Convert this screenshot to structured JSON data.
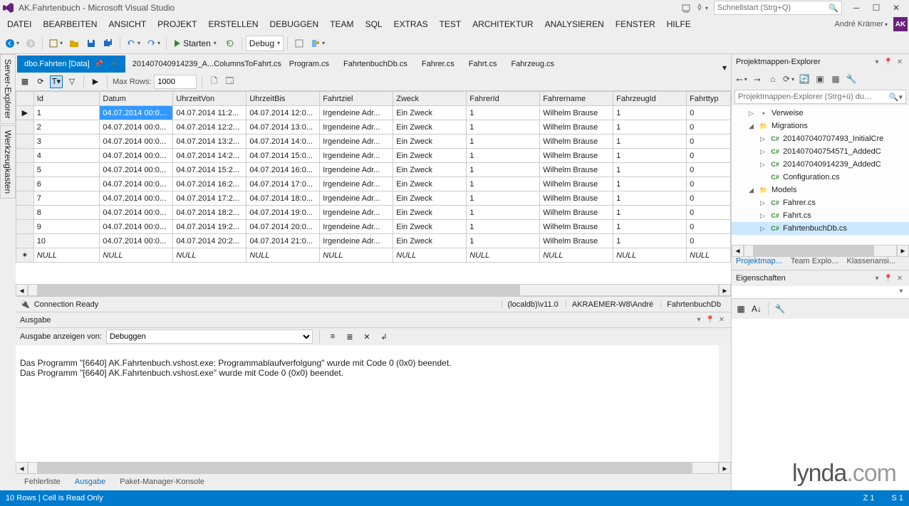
{
  "title": "AK.Fahrtenbuch - Microsoft Visual Studio",
  "quicklaunch_placeholder": "Schnellstart (Strg+Q)",
  "user_name": "André Krämer",
  "user_initials": "AK",
  "menu": [
    "DATEI",
    "BEARBEITEN",
    "ANSICHT",
    "PROJEKT",
    "ERSTELLEN",
    "DEBUGGEN",
    "TEAM",
    "SQL",
    "EXTRAS",
    "TEST",
    "ARCHITEKTUR",
    "ANALYSIEREN",
    "FENSTER",
    "HILFE"
  ],
  "toolbar": {
    "start": "Starten",
    "config": "Debug"
  },
  "sidetabs": [
    "Server-Explorer",
    "Werkzeugkasten"
  ],
  "doctabs": [
    {
      "label": "dbo.Fahrten [Data]",
      "active": true
    },
    {
      "label": "201407040914239_A...ColumnsToFahrt.cs"
    },
    {
      "label": "Program.cs"
    },
    {
      "label": "FahrtenbuchDb.cs"
    },
    {
      "label": "Fahrer.cs"
    },
    {
      "label": "Fahrt.cs"
    },
    {
      "label": "Fahrzeug.cs"
    }
  ],
  "datatool": {
    "maxrows_label": "Max Rows:",
    "maxrows_value": "1000"
  },
  "columns": [
    "Id",
    "Datum",
    "UhrzeitVon",
    "UhrzeitBis",
    "Fahrtziel",
    "Zweck",
    "FahrerId",
    "Fahrername",
    "FahrzeugId",
    "Fahrttyp"
  ],
  "rows": [
    {
      "id": "1",
      "datum": "04.07.2014 00:00:00",
      "von": "04.07.2014 11:2...",
      "bis": "04.07.2014 12:0...",
      "ziel": "Irgendeine Adr...",
      "zweck": "Ein Zweck",
      "fid": "1",
      "fname": "Wilhelm Brause",
      "fzid": "1",
      "ft": "0",
      "row_indicator": "▶",
      "sel": "datum"
    },
    {
      "id": "2",
      "datum": "04.07.2014 00:0...",
      "von": "04.07.2014 12:2...",
      "bis": "04.07.2014 13:0...",
      "ziel": "Irgendeine Adr...",
      "zweck": "Ein Zweck",
      "fid": "1",
      "fname": "Wilhelm Brause",
      "fzid": "1",
      "ft": "0"
    },
    {
      "id": "3",
      "datum": "04.07.2014 00:0...",
      "von": "04.07.2014 13:2...",
      "bis": "04.07.2014 14:0...",
      "ziel": "Irgendeine Adr...",
      "zweck": "Ein Zweck",
      "fid": "1",
      "fname": "Wilhelm Brause",
      "fzid": "1",
      "ft": "0"
    },
    {
      "id": "4",
      "datum": "04.07.2014 00:0...",
      "von": "04.07.2014 14:2...",
      "bis": "04.07.2014 15:0...",
      "ziel": "Irgendeine Adr...",
      "zweck": "Ein Zweck",
      "fid": "1",
      "fname": "Wilhelm Brause",
      "fzid": "1",
      "ft": "0"
    },
    {
      "id": "5",
      "datum": "04.07.2014 00:0...",
      "von": "04.07.2014 15:2...",
      "bis": "04.07.2014 16:0...",
      "ziel": "Irgendeine Adr...",
      "zweck": "Ein Zweck",
      "fid": "1",
      "fname": "Wilhelm Brause",
      "fzid": "1",
      "ft": "0"
    },
    {
      "id": "6",
      "datum": "04.07.2014 00:0...",
      "von": "04.07.2014 16:2...",
      "bis": "04.07.2014 17:0...",
      "ziel": "Irgendeine Adr...",
      "zweck": "Ein Zweck",
      "fid": "1",
      "fname": "Wilhelm Brause",
      "fzid": "1",
      "ft": "0"
    },
    {
      "id": "7",
      "datum": "04.07.2014 00:0...",
      "von": "04.07.2014 17:2...",
      "bis": "04.07.2014 18:0...",
      "ziel": "Irgendeine Adr...",
      "zweck": "Ein Zweck",
      "fid": "1",
      "fname": "Wilhelm Brause",
      "fzid": "1",
      "ft": "0"
    },
    {
      "id": "8",
      "datum": "04.07.2014 00:0...",
      "von": "04.07.2014 18:2...",
      "bis": "04.07.2014 19:0...",
      "ziel": "Irgendeine Adr...",
      "zweck": "Ein Zweck",
      "fid": "1",
      "fname": "Wilhelm Brause",
      "fzid": "1",
      "ft": "0"
    },
    {
      "id": "9",
      "datum": "04.07.2014 00:0...",
      "von": "04.07.2014 19:2...",
      "bis": "04.07.2014 20:0...",
      "ziel": "Irgendeine Adr...",
      "zweck": "Ein Zweck",
      "fid": "1",
      "fname": "Wilhelm Brause",
      "fzid": "1",
      "ft": "0"
    },
    {
      "id": "10",
      "datum": "04.07.2014 00:0...",
      "von": "04.07.2014 20:2...",
      "bis": "04.07.2014 21:0...",
      "ziel": "Irgendeine Adr...",
      "zweck": "Ein Zweck",
      "fid": "1",
      "fname": "Wilhelm Brause",
      "fzid": "1",
      "ft": "0"
    }
  ],
  "nullrow_marker": "✶",
  "null_label": "NULL",
  "conn": {
    "status": "Connection Ready",
    "server": "(localdb)\\v11.0",
    "login": "AKRAEMER-W8\\André",
    "db": "FahrtenbuchDb"
  },
  "output": {
    "title": "Ausgabe",
    "showfrom_label": "Ausgabe anzeigen von:",
    "showfrom_value": "Debuggen",
    "lines": [
      "Das Programm \"[6640] AK.Fahrtenbuch.vshost.exe: Programmablaufverfolgung\" wurde mit Code 0 (0x0) beendet.",
      "Das Programm \"[6640] AK.Fahrtenbuch.vshost.exe\" wurde mit Code 0 (0x0) beendet."
    ]
  },
  "bottom_tabs": [
    "Fehlerliste",
    "Ausgabe",
    "Paket-Manager-Konsole"
  ],
  "bottom_tabs_active": 1,
  "solution": {
    "title": "Projektmappen-Explorer",
    "search_placeholder": "Projektmappen-Explorer (Strg+ü) durchsuchen",
    "nodes": [
      {
        "indent": 1,
        "tw": "▷",
        "icon": "▪",
        "label": "Verweise"
      },
      {
        "indent": 1,
        "tw": "◢",
        "icon": "📁",
        "label": "Migrations"
      },
      {
        "indent": 2,
        "tw": "▷",
        "icon": "C#",
        "label": "201407040707493_InitialCre"
      },
      {
        "indent": 2,
        "tw": "▷",
        "icon": "C#",
        "label": "201407040754571_AddedC"
      },
      {
        "indent": 2,
        "tw": "▷",
        "icon": "C#",
        "label": "201407040914239_AddedC"
      },
      {
        "indent": 2,
        "tw": "",
        "icon": "C#",
        "label": "Configuration.cs"
      },
      {
        "indent": 1,
        "tw": "◢",
        "icon": "📁",
        "label": "Models"
      },
      {
        "indent": 2,
        "tw": "▷",
        "icon": "C#",
        "label": "Fahrer.cs"
      },
      {
        "indent": 2,
        "tw": "▷",
        "icon": "C#",
        "label": "Fahrt.cs"
      },
      {
        "indent": 2,
        "tw": "▷",
        "icon": "C#",
        "label": "FahrtenbuchDb.cs",
        "selected": true
      }
    ],
    "tabs": [
      "Projektmap...",
      "Team Explo...",
      "Klassenansi..."
    ]
  },
  "props": {
    "title": "Eigenschaften"
  },
  "status": {
    "left": "10 Rows | Cell is Read Only",
    "z": "Z 1",
    "s": "S 1"
  },
  "watermark": "lynda.com"
}
